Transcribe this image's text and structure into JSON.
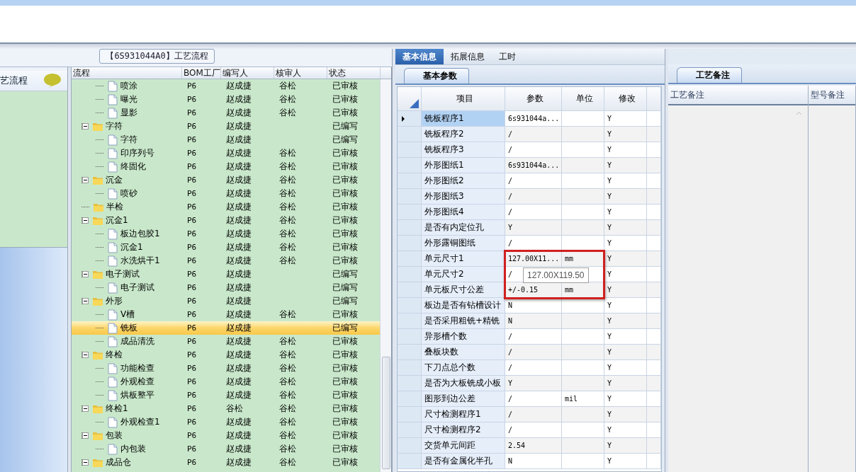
{
  "group_title": "【6S931044A0】工艺流程",
  "side_panel": {
    "title": "艺流程"
  },
  "tree": {
    "columns": [
      "流程",
      "BOM工厂",
      "编写人",
      "核审人",
      "状态"
    ],
    "rows": [
      {
        "children": [
          {
            "label": "喷涂",
            "kind": "file",
            "bom": "P6",
            "writer": "赵成捷",
            "reviewer": "谷松",
            "status": "已审核",
            "selected": false
          },
          {
            "label": "曝光",
            "kind": "file",
            "bom": "P6",
            "writer": "赵成捷",
            "reviewer": "谷松",
            "status": "已审核",
            "selected": false
          },
          {
            "label": "显影",
            "kind": "file",
            "bom": "P6",
            "writer": "赵成捷",
            "reviewer": "谷松",
            "status": "已审核",
            "selected": false
          }
        ]
      },
      {
        "label": "字符",
        "kind": "folder",
        "expanded": true,
        "bom": "P6",
        "writer": "赵成捷",
        "status": "已编写",
        "selected": false,
        "children": [
          {
            "label": "字符",
            "kind": "file",
            "bom": "P6",
            "writer": "赵成捷",
            "status": "已编写",
            "selected": false
          },
          {
            "label": "印序列号",
            "kind": "file",
            "bom": "P6",
            "writer": "赵成捷",
            "reviewer": "谷松",
            "status": "已审核",
            "selected": false
          },
          {
            "label": "终固化",
            "kind": "file",
            "bom": "P6",
            "writer": "赵成捷",
            "reviewer": "谷松",
            "status": "已审核",
            "selected": false
          }
        ]
      },
      {
        "label": "沉金",
        "kind": "folder",
        "expanded": true,
        "bom": "P6",
        "writer": "赵成捷",
        "reviewer": "谷松",
        "status": "已审核",
        "selected": false,
        "children": [
          {
            "label": "喷砂",
            "kind": "file",
            "bom": "P6",
            "writer": "赵成捷",
            "reviewer": "谷松",
            "status": "已审核",
            "selected": false
          }
        ]
      },
      {
        "label": "半检",
        "kind": "folder",
        "bom": "P6",
        "writer": "赵成捷",
        "reviewer": "谷松",
        "status": "已审核",
        "selected": false
      },
      {
        "label": "沉金1",
        "kind": "folder",
        "expanded": true,
        "bom": "P6",
        "writer": "赵成捷",
        "reviewer": "谷松",
        "status": "已审核",
        "selected": false,
        "children": [
          {
            "label": "板边包胶1",
            "kind": "file",
            "bom": "P6",
            "writer": "赵成捷",
            "reviewer": "谷松",
            "status": "已审核",
            "selected": false
          },
          {
            "label": "沉金1",
            "kind": "file",
            "bom": "P6",
            "writer": "赵成捷",
            "reviewer": "谷松",
            "status": "已审核",
            "selected": false
          },
          {
            "label": "水洗烘干1",
            "kind": "file",
            "bom": "P6",
            "writer": "赵成捷",
            "reviewer": "谷松",
            "status": "已审核",
            "selected": false
          }
        ]
      },
      {
        "label": "电子测试",
        "kind": "folder",
        "expanded": true,
        "bom": "P6",
        "writer": "赵成捷",
        "status": "已编写",
        "selected": false,
        "children": [
          {
            "label": "电子测试",
            "kind": "file",
            "bom": "P6",
            "writer": "赵成捷",
            "status": "已编写",
            "selected": false
          }
        ]
      },
      {
        "label": "外形",
        "kind": "folder",
        "expanded": true,
        "bom": "P6",
        "writer": "赵成捷",
        "status": "已编写",
        "selected": false,
        "children": [
          {
            "label": "V槽",
            "kind": "file",
            "bom": "P6",
            "writer": "赵成捷",
            "reviewer": "谷松",
            "status": "已审核",
            "selected": false
          },
          {
            "label": "铣板",
            "kind": "file",
            "bom": "P6",
            "writer": "赵成捷",
            "status": "已编写",
            "selected": true
          },
          {
            "label": "成品清洗",
            "kind": "file",
            "bom": "P6",
            "writer": "赵成捷",
            "reviewer": "谷松",
            "status": "已审核",
            "selected": false
          }
        ]
      },
      {
        "label": "终检",
        "kind": "folder",
        "expanded": true,
        "bom": "P6",
        "writer": "赵成捷",
        "reviewer": "谷松",
        "status": "已审核",
        "selected": false,
        "children": [
          {
            "label": "功能检查",
            "kind": "file",
            "bom": "P6",
            "writer": "赵成捷",
            "reviewer": "谷松",
            "status": "已审核",
            "selected": false
          },
          {
            "label": "外观检查",
            "kind": "file",
            "bom": "P6",
            "writer": "赵成捷",
            "reviewer": "谷松",
            "status": "已审核",
            "selected": false
          },
          {
            "label": "烘板整平",
            "kind": "file",
            "bom": "P6",
            "writer": "赵成捷",
            "reviewer": "谷松",
            "status": "已审核",
            "selected": false
          }
        ]
      },
      {
        "label": "终检1",
        "kind": "folder",
        "expanded": true,
        "bom": "P6",
        "writer": "谷松",
        "reviewer": "谷松",
        "status": "已审核",
        "selected": false,
        "children": [
          {
            "label": "外观检查1",
            "kind": "file",
            "bom": "P6",
            "writer": "赵成捷",
            "reviewer": "谷松",
            "status": "已审核",
            "selected": false
          }
        ]
      },
      {
        "label": "包装",
        "kind": "folder",
        "expanded": true,
        "bom": "P6",
        "writer": "赵成捷",
        "reviewer": "谷松",
        "status": "已审核",
        "selected": false,
        "children": [
          {
            "label": "内包装",
            "kind": "file",
            "bom": "P6",
            "writer": "赵成捷",
            "reviewer": "谷松",
            "status": "已审核",
            "selected": false
          }
        ]
      },
      {
        "label": "成品仓",
        "kind": "folder",
        "expanded": true,
        "bom": "P6",
        "writer": "赵成捷",
        "reviewer": "谷松",
        "status": "已审核",
        "selected": false
      }
    ]
  },
  "tabs": [
    {
      "label": "基本信息",
      "selected": true
    },
    {
      "label": "拓展信息",
      "selected": false
    },
    {
      "label": "工时",
      "selected": false
    }
  ],
  "params": {
    "tab": "基本参数",
    "columns": [
      "项目",
      "参数",
      "单位",
      "修改"
    ],
    "rows": [
      {
        "item": "铣板程序1",
        "value": "6s931044a...",
        "modify": "Y",
        "selected": true
      },
      {
        "item": "铣板程序2",
        "value": "/",
        "modify": "Y",
        "selected": false
      },
      {
        "item": "铣板程序3",
        "value": "/",
        "modify": "Y",
        "selected": false
      },
      {
        "item": "外形图纸1",
        "value": "6s931044a...",
        "modify": "Y",
        "selected": false
      },
      {
        "item": "外形图纸2",
        "value": "/",
        "modify": "Y",
        "selected": false
      },
      {
        "item": "外形图纸3",
        "value": "/",
        "modify": "Y",
        "selected": false
      },
      {
        "item": "外形图纸4",
        "value": "/",
        "modify": "Y",
        "selected": false
      },
      {
        "item": "是否有内定位孔",
        "value": "Y",
        "modify": "Y",
        "selected": false
      },
      {
        "item": "外形露铜图纸",
        "value": "/",
        "modify": "Y",
        "selected": false
      },
      {
        "item": "单元尺寸1",
        "value": "127.00X11...",
        "unit": "mm",
        "modify": "Y",
        "selected": false
      },
      {
        "item": "单元尺寸2",
        "value": "/",
        "modify": "Y",
        "selected": false
      },
      {
        "item": "单元板尺寸公差",
        "value": "+/-0.15",
        "unit": "mm",
        "modify": "Y",
        "selected": false
      },
      {
        "item": "板边是否有钻槽设计",
        "value": "N",
        "modify": "Y",
        "selected": false
      },
      {
        "item": "是否采用粗铣+精铣",
        "value": "N",
        "modify": "Y",
        "selected": false
      },
      {
        "item": "异形槽个数",
        "value": "/",
        "modify": "Y",
        "selected": false
      },
      {
        "item": "叠板块数",
        "value": "/",
        "modify": "Y",
        "selected": false
      },
      {
        "item": "下刀点总个数",
        "value": "/",
        "modify": "Y",
        "selected": false
      },
      {
        "item": "是否为大板铣成小板",
        "value": "Y",
        "modify": "Y",
        "selected": false
      },
      {
        "item": "图形到边公差",
        "value": "/",
        "unit": "mil",
        "modify": "Y",
        "selected": false
      },
      {
        "item": "尺寸检测程序1",
        "value": "/",
        "modify": "Y",
        "selected": false
      },
      {
        "item": "尺寸检测程序2",
        "value": "/",
        "modify": "Y",
        "selected": false
      },
      {
        "item": "交货单元间距",
        "value": "2.54",
        "modify": "Y",
        "selected": false
      },
      {
        "item": "是否有金属化半孔",
        "value": "N",
        "modify": "Y",
        "selected": false
      }
    ],
    "tooltip": "127.00X119.50"
  },
  "notes": {
    "tab": "工艺备注",
    "columns": [
      "工艺备注",
      "型号备注"
    ]
  }
}
